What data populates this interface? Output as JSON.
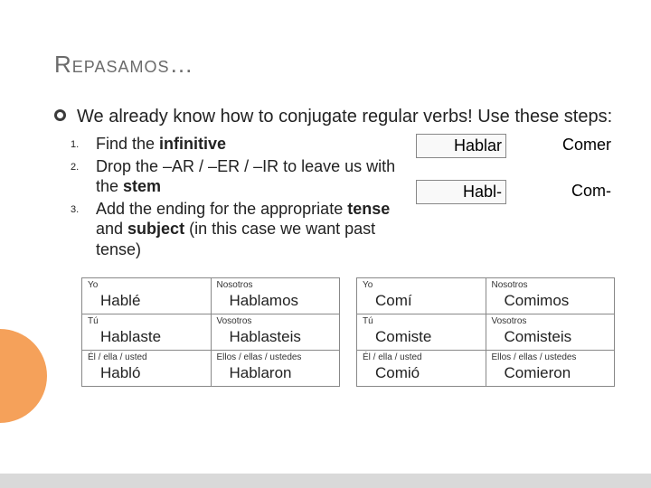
{
  "title": "Repasamos…",
  "intro": "We already know how to conjugate regular verbs! Use these steps:",
  "steps": {
    "n1": "1.",
    "n2": "2.",
    "n3": "3.",
    "s1a": "Find the ",
    "s1b": "infinitive",
    "s2a": "Drop the –AR / –ER / –IR to leave us with the ",
    "s2b": "stem",
    "s3a": "Add the ending for the appropriate ",
    "s3b": "tense",
    "s3c": " and ",
    "s3d": "subject",
    "s3e": "  (in this case we want past tense)"
  },
  "side": {
    "inf1": "Hablar",
    "inf2": "Comer",
    "stem1": "Habl-",
    "stem2": "Com-"
  },
  "pronouns": {
    "yo": "Yo",
    "nos": "Nosotros",
    "tu": "Tú",
    "vos": "Vosotros",
    "el": "Él / ella / usted",
    "ellos": "Ellos / ellas / ustedes"
  },
  "hablar": {
    "yo": "Hablé",
    "nos": "Hablamos",
    "tu": "Hablaste",
    "vos": "Hablasteis",
    "el": "Habló",
    "ellos": "Hablaron"
  },
  "comer": {
    "yo": "Comí",
    "nos": "Comimos",
    "tu": "Comiste",
    "vos": "Comisteis",
    "el": "Comió",
    "ellos": "Comieron"
  }
}
